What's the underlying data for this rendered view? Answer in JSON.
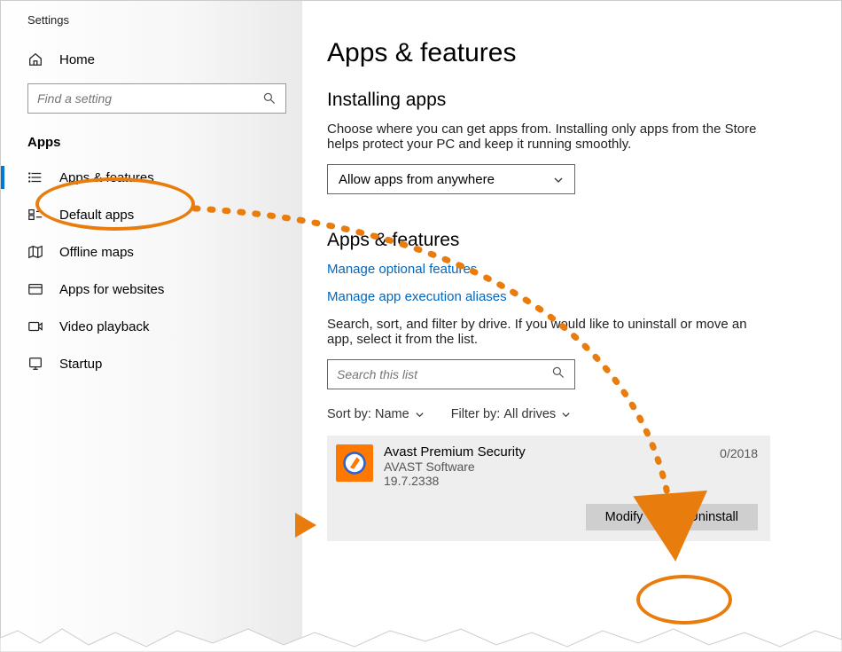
{
  "window": {
    "title": "Settings"
  },
  "sidebar": {
    "home": "Home",
    "search_placeholder": "Find a setting",
    "section": "Apps",
    "items": [
      {
        "label": "Apps & features"
      },
      {
        "label": "Default apps"
      },
      {
        "label": "Offline maps"
      },
      {
        "label": "Apps for websites"
      },
      {
        "label": "Video playback"
      },
      {
        "label": "Startup"
      }
    ]
  },
  "main": {
    "title": "Apps & features",
    "install": {
      "heading": "Installing apps",
      "desc": "Choose where you can get apps from. Installing only apps from the Store helps protect your PC and keep it running smoothly.",
      "dropdown": "Allow apps from anywhere"
    },
    "apps": {
      "heading": "Apps & features",
      "link_optional": "Manage optional features",
      "link_aliases": "Manage app execution aliases",
      "desc": "Search, sort, and filter by drive. If you would like to uninstall or move an app, select it from the list.",
      "search_placeholder": "Search this list",
      "sort_label": "Sort by:",
      "sort_value": "Name",
      "filter_label": "Filter by:",
      "filter_value": "All drives"
    },
    "app_card": {
      "name": "Avast Premium Security",
      "publisher": "AVAST Software",
      "version": "19.7.2338",
      "date_partial": "0/2018",
      "modify": "Modify",
      "uninstall": "Uninstall"
    }
  }
}
